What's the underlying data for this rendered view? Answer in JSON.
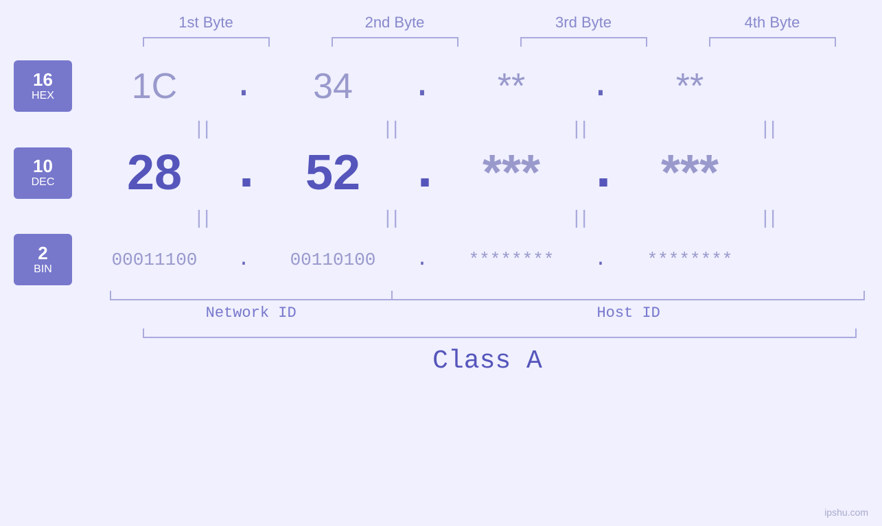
{
  "headers": {
    "byte1": "1st Byte",
    "byte2": "2nd Byte",
    "byte3": "3rd Byte",
    "byte4": "4th Byte"
  },
  "rows": {
    "hex": {
      "badge_num": "16",
      "badge_label": "HEX",
      "byte1": "1C",
      "byte2": "34",
      "byte3": "**",
      "byte4": "**"
    },
    "dec": {
      "badge_num": "10",
      "badge_label": "DEC",
      "byte1": "28",
      "byte2": "52",
      "byte3": "***",
      "byte4": "***"
    },
    "bin": {
      "badge_num": "2",
      "badge_label": "BIN",
      "byte1": "00011100",
      "byte2": "00110100",
      "byte3": "********",
      "byte4": "********"
    }
  },
  "equals": "||",
  "labels": {
    "network_id": "Network ID",
    "host_id": "Host ID",
    "class": "Class A"
  },
  "watermark": "ipshu.com"
}
